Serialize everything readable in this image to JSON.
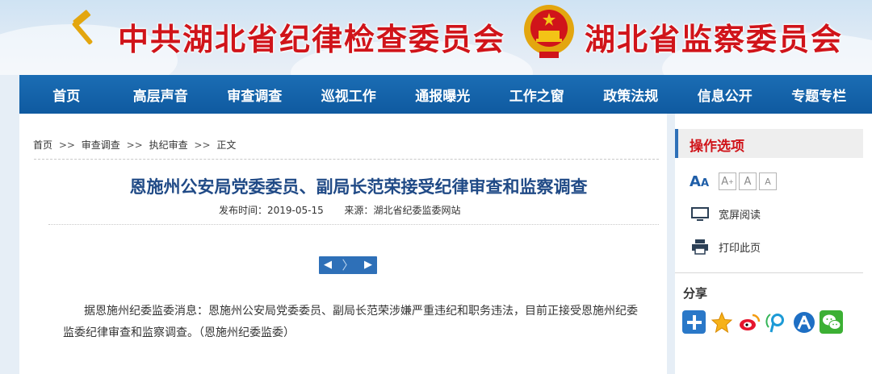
{
  "header": {
    "org_name_1": "中共湖北省纪律检查委员会",
    "org_name_2": "湖北省监察委员会"
  },
  "nav": {
    "items": [
      "首页",
      "高层声音",
      "审查调查",
      "巡视工作",
      "通报曝光",
      "工作之窗",
      "政策法规",
      "信息公开",
      "专题专栏"
    ]
  },
  "breadcrumb": {
    "items": [
      "首页",
      "审查调查",
      "执纪审查",
      "正文"
    ],
    "separator": ">>"
  },
  "article": {
    "title": "恩施州公安局党委委员、副局长范荣接受纪律审查和监察调查",
    "date_label": "发布时间：",
    "date": "2019-05-15",
    "source_label": "来源：",
    "source": "湖北省纪委监委网站",
    "body": "据恩施州纪委监委消息：恩施州公安局党委委员、副局长范荣涉嫌严重违纪和职务违法，目前正接受恩施州纪委监委纪律审查和监察调查。（恩施州纪委监委）"
  },
  "pager": {
    "prev_icon": "◀",
    "next_icon": "▶"
  },
  "sidebar": {
    "heading": "操作选项",
    "font_size_label": "A",
    "font_size_label_small": "A",
    "font_size_options": [
      "A",
      "A",
      "A"
    ],
    "wide_read_label": "宽屏阅读",
    "print_label": "打印此页",
    "share_label": "分享",
    "share_targets": [
      "plus-icon",
      "star-icon",
      "weibo-icon",
      "tencent-weibo-icon",
      "renren-icon",
      "wechat-icon"
    ]
  },
  "colors": {
    "nav_blue": "#1565ad",
    "title_red": "#d0141a",
    "article_title_blue": "#204a86",
    "pager_blue": "#2e70b8"
  }
}
